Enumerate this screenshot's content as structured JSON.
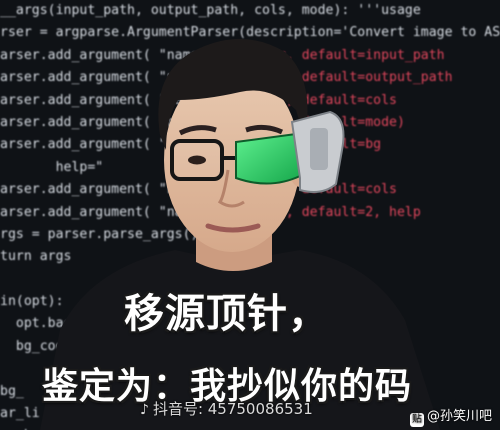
{
  "code_lines": [
    "__args(input_path, output_path, cols, mode): '''usage",
    "rser = argparse.ArgumentParser(description='Convert image to ASCII')",
    "arser.add_argument( \"name\", type=str, default=input_path",
    "arser.add_argument( \"name\", type=str, default=output_path",
    "arser.add_argument( \"name\", type=str, default=cols",
    "arser.add_argument( \"name\", type=str, default=mode)",
    "arser.add_argument( \"name\", type=str, default=bg",
    "       help=\"",
    "arser.add_argument( \"name\", type=int, default=cols",
    "arser.add_argument( \"name\", type=int, default=2, help",
    "rgs = parser.parse_args()",
    "turn args",
    "",
    "in(opt):",
    "  opt.background",
    "  bg_code",
    "",
    "bg_",
    "ar_li",
    "n_char"
  ],
  "caption": {
    "line1": "移源顶针，",
    "line2": "鉴定为：我抄似你的码"
  },
  "watermark": {
    "icon": "tiktok-icon",
    "text": "抖音号: 45750086531"
  },
  "credit": {
    "text": "@孙笑川吧"
  }
}
